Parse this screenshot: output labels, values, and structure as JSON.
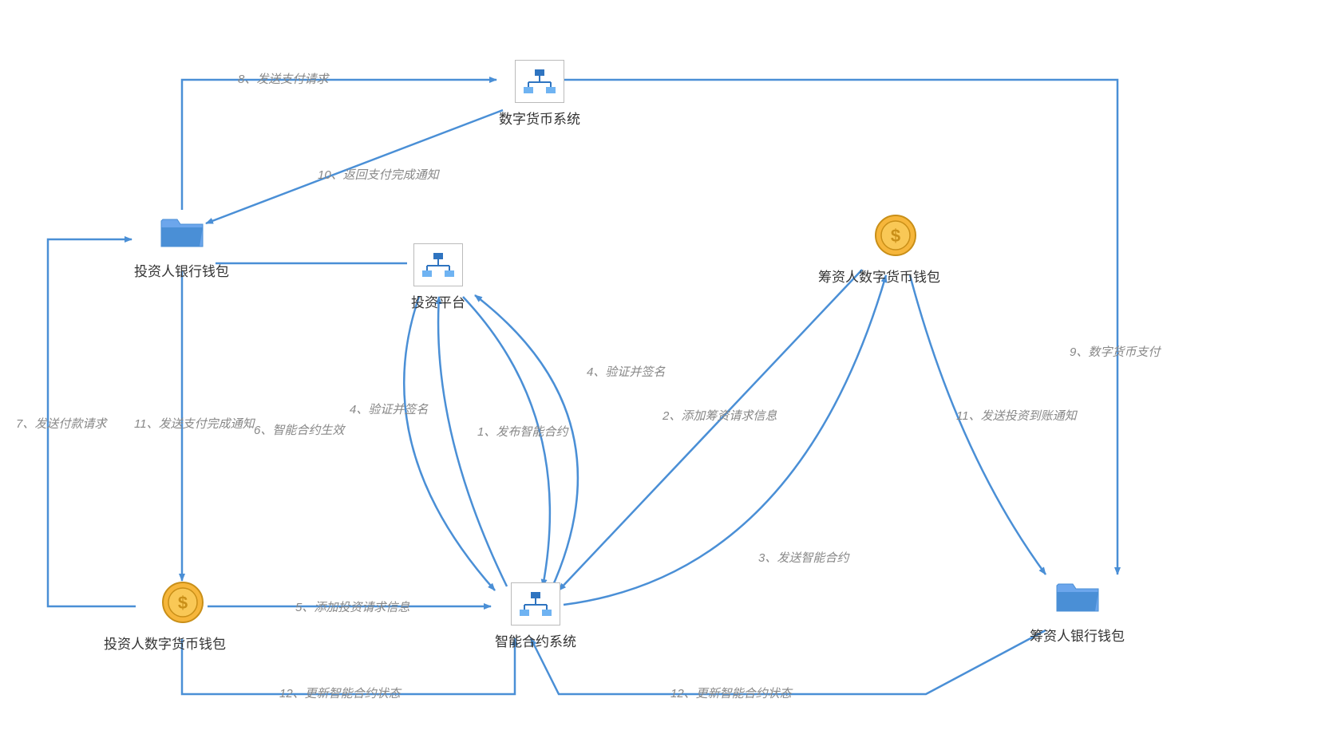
{
  "nodes": {
    "digital_currency_system": {
      "label": "数字货币系统"
    },
    "investor_bank_wallet": {
      "label": "投资人银行钱包"
    },
    "investment_platform": {
      "label": "投资平台"
    },
    "fundraiser_digital_wallet": {
      "label": "筹资人数字货币钱包"
    },
    "investor_digital_wallet": {
      "label": "投资人数字货币钱包"
    },
    "smart_contract_system": {
      "label": "智能合约系统"
    },
    "fundraiser_bank_wallet": {
      "label": "筹资人银行钱包"
    }
  },
  "edges": {
    "e1": {
      "label": "1、发布智能合约"
    },
    "e2": {
      "label": "2、添加筹资请求信息"
    },
    "e3": {
      "label": "3、发送智能合约"
    },
    "e4a": {
      "label": "4、验证并签名"
    },
    "e4b": {
      "label": "4、验证并签名"
    },
    "e5": {
      "label": "5、添加投资请求信息"
    },
    "e6": {
      "label": "6、智能合约生效"
    },
    "e7": {
      "label": "7、发送付款请求"
    },
    "e8": {
      "label": "8、发送支付请求"
    },
    "e9": {
      "label": "9、数字货币支付"
    },
    "e10": {
      "label": "10、返回支付完成通知"
    },
    "e11a": {
      "label": "11、发送支付完成通知"
    },
    "e11b": {
      "label": "11、发送投资到账通知"
    },
    "e12a": {
      "label": "12、更新智能合约状态"
    },
    "e12b": {
      "label": "12、更新智能合约状态"
    }
  },
  "colors": {
    "arrow": "#4a8fd6",
    "label_text": "#888888"
  }
}
